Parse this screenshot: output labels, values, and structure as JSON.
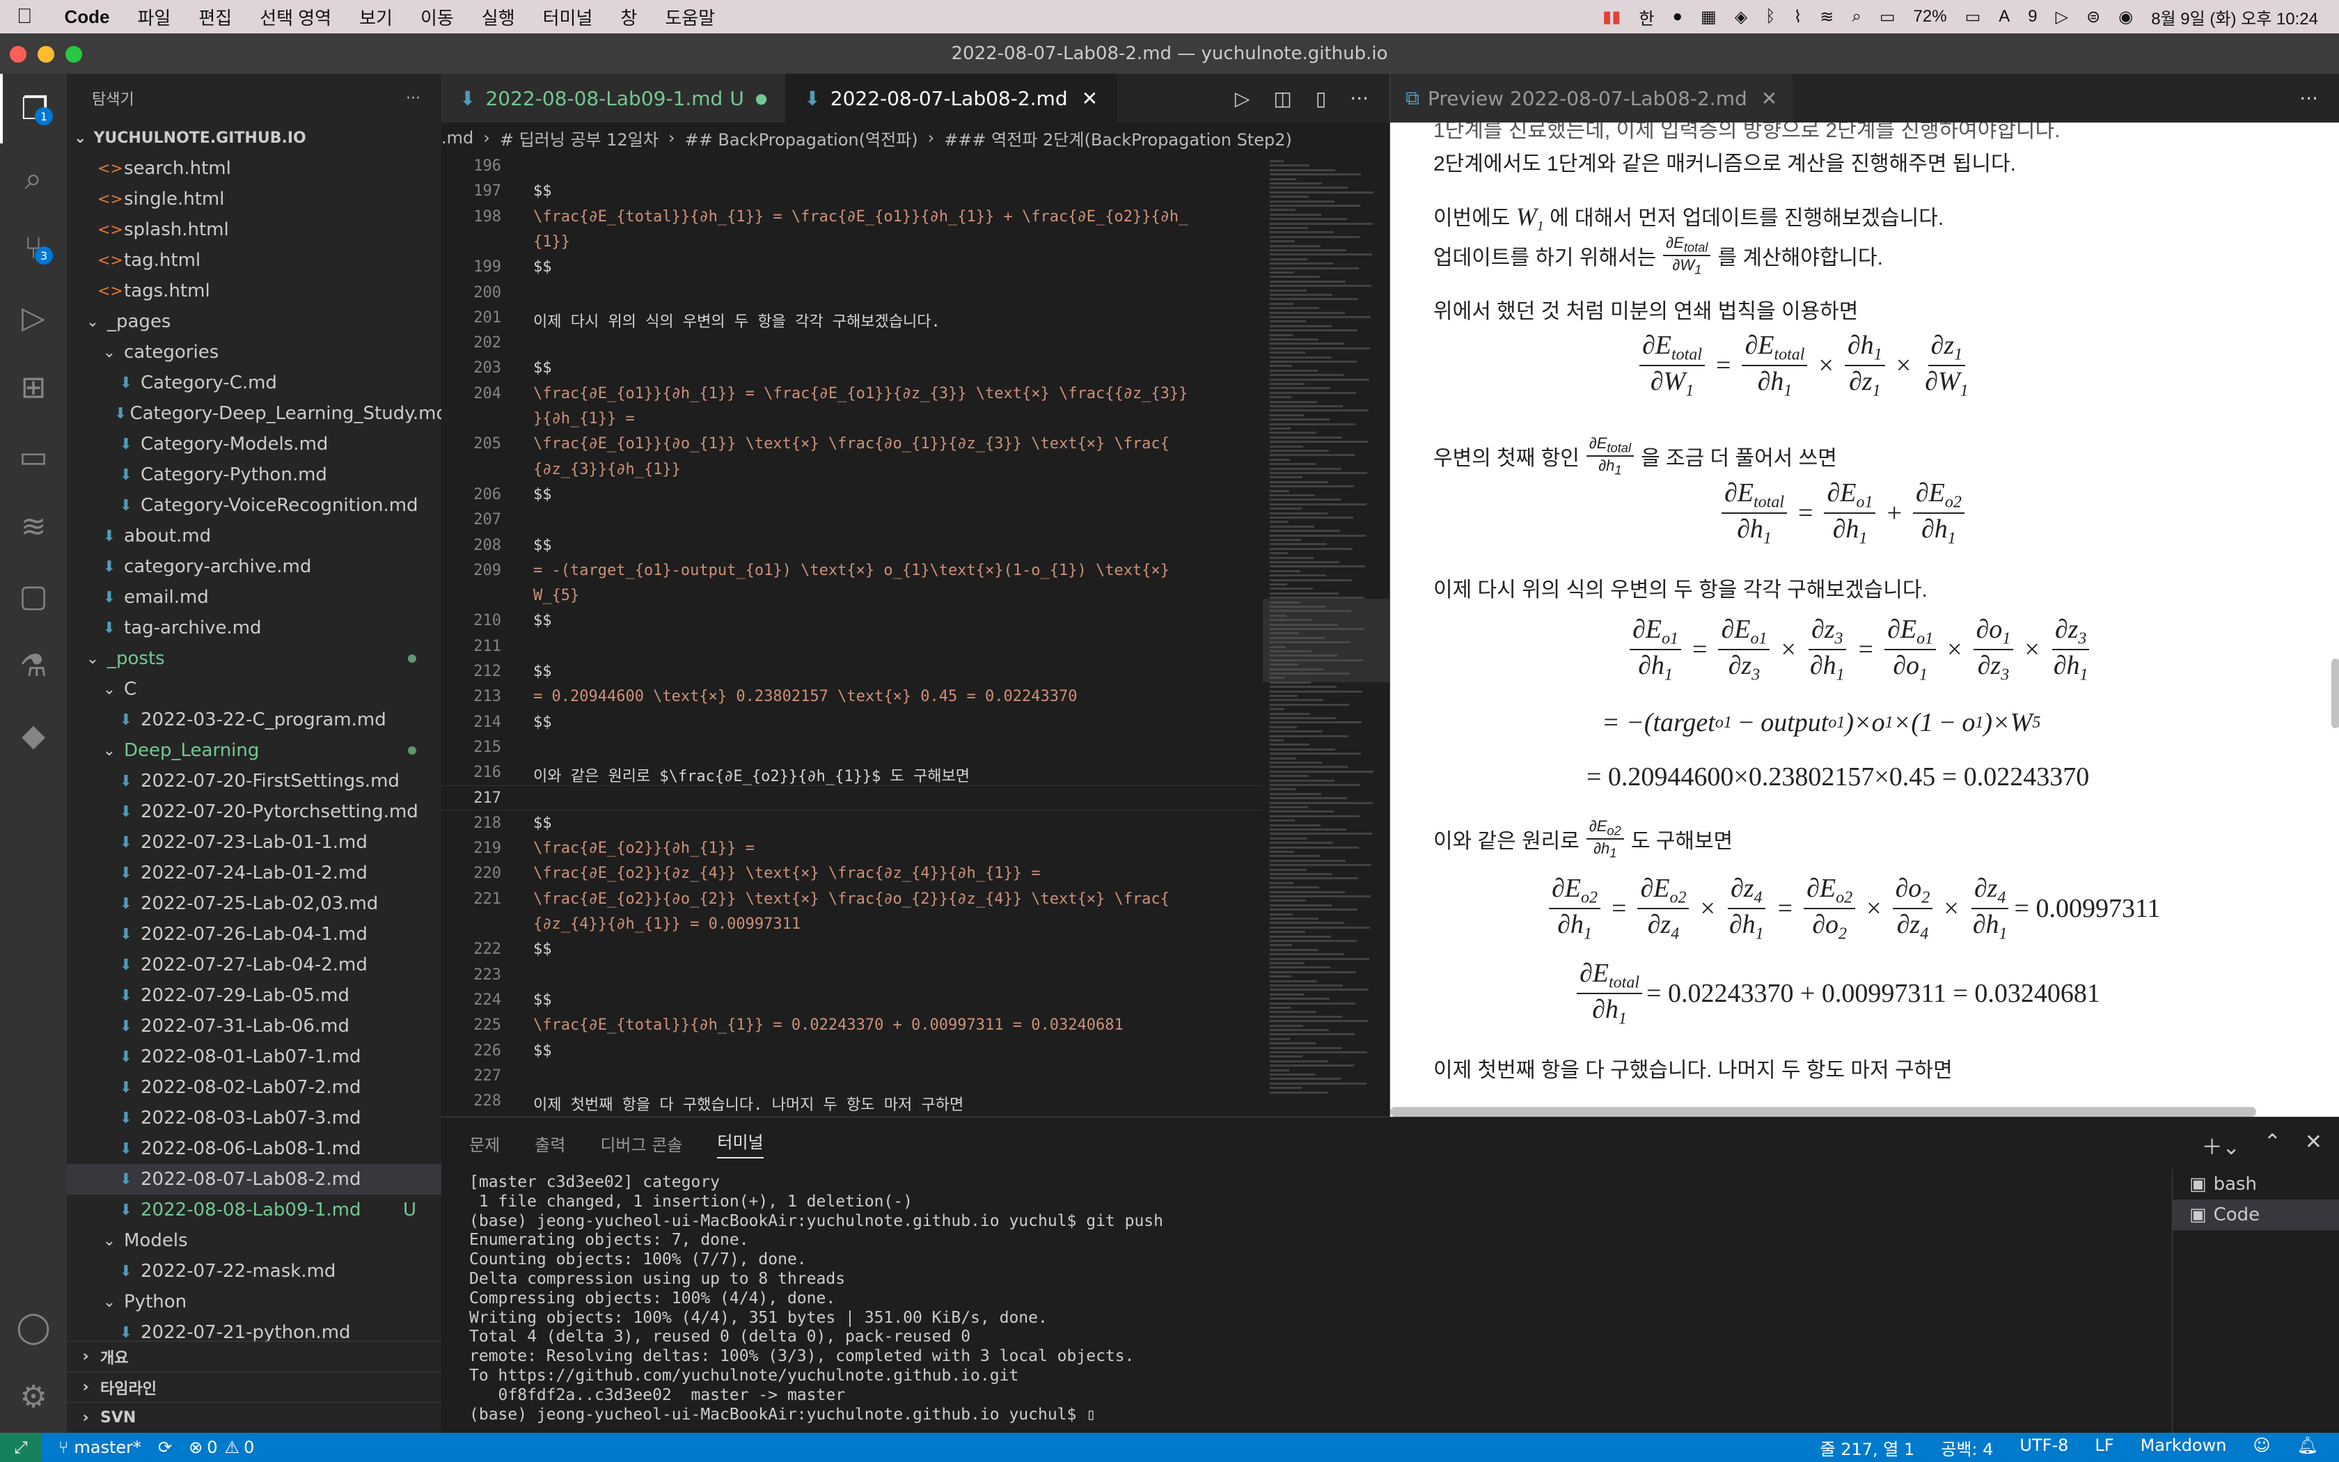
{
  "menubar": {
    "app": "Code",
    "items": [
      "파일",
      "편집",
      "선택 영역",
      "보기",
      "이동",
      "실행",
      "터미널",
      "창",
      "도움말"
    ],
    "battery": "72%",
    "calendar_badge": "9",
    "datetime": "8월 9일 (화) 오후 10:24"
  },
  "window": {
    "title": "2022-08-07-Lab08-2.md — yuchulnote.github.io"
  },
  "activity": {
    "explorer_badge": "1",
    "scm_badge": "3"
  },
  "sidebar": {
    "header": "탐색기",
    "root": "YUCHULNOTE.GITHUB.IO",
    "items": [
      {
        "label": "search.html",
        "type": "html",
        "indent": 1
      },
      {
        "label": "single.html",
        "type": "html",
        "indent": 1
      },
      {
        "label": "splash.html",
        "type": "html",
        "indent": 1
      },
      {
        "label": "tag.html",
        "type": "html",
        "indent": 1
      },
      {
        "label": "tags.html",
        "type": "html",
        "indent": 1
      },
      {
        "label": "_pages",
        "type": "folder-open",
        "indent": 0
      },
      {
        "label": "categories",
        "type": "folder-open",
        "indent": 1
      },
      {
        "label": "Category-C.md",
        "type": "md",
        "indent": 2
      },
      {
        "label": "Category-Deep_Learning_Study.md",
        "type": "md",
        "indent": 2
      },
      {
        "label": "Category-Models.md",
        "type": "md",
        "indent": 2
      },
      {
        "label": "Category-Python.md",
        "type": "md",
        "indent": 2
      },
      {
        "label": "Category-VoiceRecognition.md",
        "type": "md",
        "indent": 2
      },
      {
        "label": "about.md",
        "type": "md",
        "indent": 1
      },
      {
        "label": "category-archive.md",
        "type": "md",
        "indent": 1
      },
      {
        "label": "email.md",
        "type": "md",
        "indent": 1
      },
      {
        "label": "tag-archive.md",
        "type": "md",
        "indent": 1
      },
      {
        "label": "_posts",
        "type": "folder-open",
        "indent": 0,
        "status": "green"
      },
      {
        "label": "C",
        "type": "folder-open",
        "indent": 1
      },
      {
        "label": "2022-03-22-C_program.md",
        "type": "md",
        "indent": 2
      },
      {
        "label": "Deep_Learning",
        "type": "folder-open",
        "indent": 1,
        "status": "green"
      },
      {
        "label": "2022-07-20-FirstSettings.md",
        "type": "md",
        "indent": 2
      },
      {
        "label": "2022-07-20-Pytorchsetting.md",
        "type": "md",
        "indent": 2
      },
      {
        "label": "2022-07-23-Lab-01-1.md",
        "type": "md",
        "indent": 2
      },
      {
        "label": "2022-07-24-Lab-01-2.md",
        "type": "md",
        "indent": 2
      },
      {
        "label": "2022-07-25-Lab-02,03.md",
        "type": "md",
        "indent": 2
      },
      {
        "label": "2022-07-26-Lab-04-1.md",
        "type": "md",
        "indent": 2
      },
      {
        "label": "2022-07-27-Lab-04-2.md",
        "type": "md",
        "indent": 2
      },
      {
        "label": "2022-07-29-Lab-05.md",
        "type": "md",
        "indent": 2
      },
      {
        "label": "2022-07-31-Lab-06.md",
        "type": "md",
        "indent": 2
      },
      {
        "label": "2022-08-01-Lab07-1.md",
        "type": "md",
        "indent": 2
      },
      {
        "label": "2022-08-02-Lab07-2.md",
        "type": "md",
        "indent": 2
      },
      {
        "label": "2022-08-03-Lab07-3.md",
        "type": "md",
        "indent": 2
      },
      {
        "label": "2022-08-06-Lab08-1.md",
        "type": "md",
        "indent": 2
      },
      {
        "label": "2022-08-07-Lab08-2.md",
        "type": "md",
        "indent": 2,
        "selected": true
      },
      {
        "label": "2022-08-08-Lab09-1.md",
        "type": "md",
        "indent": 2,
        "status": "U"
      },
      {
        "label": "Models",
        "type": "folder-open",
        "indent": 1
      },
      {
        "label": "2022-07-22-mask.md",
        "type": "md",
        "indent": 2
      },
      {
        "label": "Python",
        "type": "folder-open",
        "indent": 1
      },
      {
        "label": "2022-07-21-python.md",
        "type": "md",
        "indent": 2
      }
    ],
    "footer": [
      "개요",
      "타임라인",
      "SVN"
    ]
  },
  "editor": {
    "tabs": [
      {
        "label": "2022-08-08-Lab09-1.md",
        "flag": "U",
        "active": false
      },
      {
        "label": "2022-08-07-Lab08-2.md",
        "active": true
      }
    ],
    "breadcrumbs": [
      ".md",
      "›",
      "# 딥러닝 공부 12일차",
      "›",
      "## BackPropagation(역전파)",
      "›",
      "### 역전파 2단계(BackPropagation Step2)"
    ],
    "lines": [
      {
        "n": "196",
        "t": ""
      },
      {
        "n": "197",
        "t": "$$"
      },
      {
        "n": "198",
        "t": "\\frac{∂E_{total}}{∂h_{1}} = \\frac{∂E_{o1}}{∂h_{1}} + \\frac{∂E_{o2}}{∂h_"
      },
      {
        "n": "",
        "t": "{1}}"
      },
      {
        "n": "199",
        "t": "$$"
      },
      {
        "n": "200",
        "t": ""
      },
      {
        "n": "201",
        "t": "이제 다시 위의 식의 우변의 두 항을 각각 구해보겠습니다."
      },
      {
        "n": "202",
        "t": ""
      },
      {
        "n": "203",
        "t": "$$"
      },
      {
        "n": "204",
        "t": "\\frac{∂E_{o1}}{∂h_{1}} = \\frac{∂E_{o1}}{∂z_{3}} \\text{×} \\frac{{∂z_{3}}"
      },
      {
        "n": "",
        "t": "}{∂h_{1}} ="
      },
      {
        "n": "205",
        "t": "\\frac{∂E_{o1}}{∂o_{1}} \\text{×} \\frac{∂o_{1}}{∂z_{3}} \\text{×} \\frac{"
      },
      {
        "n": "",
        "t": "{∂z_{3}}{∂h_{1}}"
      },
      {
        "n": "206",
        "t": "$$"
      },
      {
        "n": "207",
        "t": ""
      },
      {
        "n": "208",
        "t": "$$"
      },
      {
        "n": "209",
        "t": "= -(target_{o1}-output_{o1}) \\text{×} o_{1}\\text{×}(1-o_{1}) \\text{×}"
      },
      {
        "n": "",
        "t": "W_{5}"
      },
      {
        "n": "210",
        "t": "$$"
      },
      {
        "n": "211",
        "t": ""
      },
      {
        "n": "212",
        "t": "$$"
      },
      {
        "n": "213",
        "t": "= 0.20944600 \\text{×} 0.23802157 \\text{×} 0.45 = 0.02243370"
      },
      {
        "n": "214",
        "t": "$$"
      },
      {
        "n": "215",
        "t": ""
      },
      {
        "n": "216",
        "t": "이와 같은 원리로 $\\frac{∂E_{o2}}{∂h_{1}}$ 도 구해보면"
      },
      {
        "n": "217",
        "t": ""
      },
      {
        "n": "218",
        "t": "$$"
      },
      {
        "n": "219",
        "t": "\\frac{∂E_{o2}}{∂h_{1}} ="
      },
      {
        "n": "220",
        "t": "\\frac{∂E_{o2}}{∂z_{4}} \\text{×} \\frac{∂z_{4}}{∂h_{1}} ="
      },
      {
        "n": "221",
        "t": "\\frac{∂E_{o2}}{∂o_{2}} \\text{×} \\frac{∂o_{2}}{∂z_{4}} \\text{×} \\frac{"
      },
      {
        "n": "",
        "t": "{∂z_{4}}{∂h_{1}} = 0.00997311"
      },
      {
        "n": "222",
        "t": "$$"
      },
      {
        "n": "223",
        "t": ""
      },
      {
        "n": "224",
        "t": "$$"
      },
      {
        "n": "225",
        "t": "\\frac{∂E_{total}}{∂h_{1}} = 0.02243370 + 0.00997311 = 0.03240681"
      },
      {
        "n": "226",
        "t": "$$"
      },
      {
        "n": "227",
        "t": ""
      },
      {
        "n": "228",
        "t": "이제 첫번째 항을 다 구했습니다. 나머지 두 항도 마저 구하면"
      }
    ]
  },
  "preview": {
    "tab": "Preview 2022-08-07-Lab08-2.md",
    "top_cut": "1단계를 진료했는데, 이제 입력층의 방향으로 2단계를 진행하여야합니다.",
    "p1": "2단계에서도 1단계와 같은 매커니즘으로 계산을 진행해주면 됩니다.",
    "p2a": "이번에도",
    "p2b": "에 대해서 먼저 업데이트를 진행해보겠습니다.",
    "p3a": "업데이트를 하기 위해서는",
    "p3b": "를 계산해야합니다.",
    "p4": "위에서 했던 것 처럼 미분의 연쇄 법칙을 이용하면",
    "p5a": "우변의 첫째 항인",
    "p5b": "을 조금 더 풀어서 쓰면",
    "p6": "이제 다시 위의 식의 우변의 두 항을 각각 구해보겠습니다.",
    "eq_line2": "= −(target",
    "eq_line3": "= 0.20944600×0.23802157×0.45 = 0.02243370",
    "p7a": "이와 같은 원리로",
    "p7b": "도 구해보면",
    "eq_val1": "= 0.00997311",
    "eq_val2": "= 0.02243370 + 0.00997311 = 0.03240681",
    "p8": "이제 첫번째 항을 다 구했습니다. 나머지 두 항도 마저 구하면"
  },
  "panel": {
    "tabs": [
      "문제",
      "출력",
      "디버그 콘솔",
      "터미널"
    ],
    "terminal_lines": [
      "[master c3d3ee02] category",
      " 1 file changed, 1 insertion(+), 1 deletion(-)",
      "(base) jeong-yucheol-ui-MacBookAir:yuchulnote.github.io yuchul$ git push",
      "Enumerating objects: 7, done.",
      "Counting objects: 100% (7/7), done.",
      "Delta compression using up to 8 threads",
      "Compressing objects: 100% (4/4), done.",
      "Writing objects: 100% (4/4), 351 bytes | 351.00 KiB/s, done.",
      "Total 4 (delta 3), reused 0 (delta 0), pack-reused 0",
      "remote: Resolving deltas: 100% (3/3), completed with 3 local objects.",
      "To https://github.com/yuchulnote/yuchulnote.github.io.git",
      "   0f8fdf2a..c3d3ee02  master -> master",
      "(base) jeong-yucheol-ui-MacBookAir:yuchulnote.github.io yuchul$ "
    ],
    "terminals": [
      "bash",
      "Code"
    ]
  },
  "status": {
    "branch": "master*",
    "errors": "0",
    "warnings": "0",
    "position": "줄 217, 열 1",
    "spaces": "공백: 4",
    "encoding": "UTF-8",
    "eol": "LF",
    "language": "Markdown"
  },
  "colors": {
    "accent": "#007acc",
    "bg": "#1e1e1e",
    "sidebar": "#252526",
    "green": "#73c991"
  }
}
